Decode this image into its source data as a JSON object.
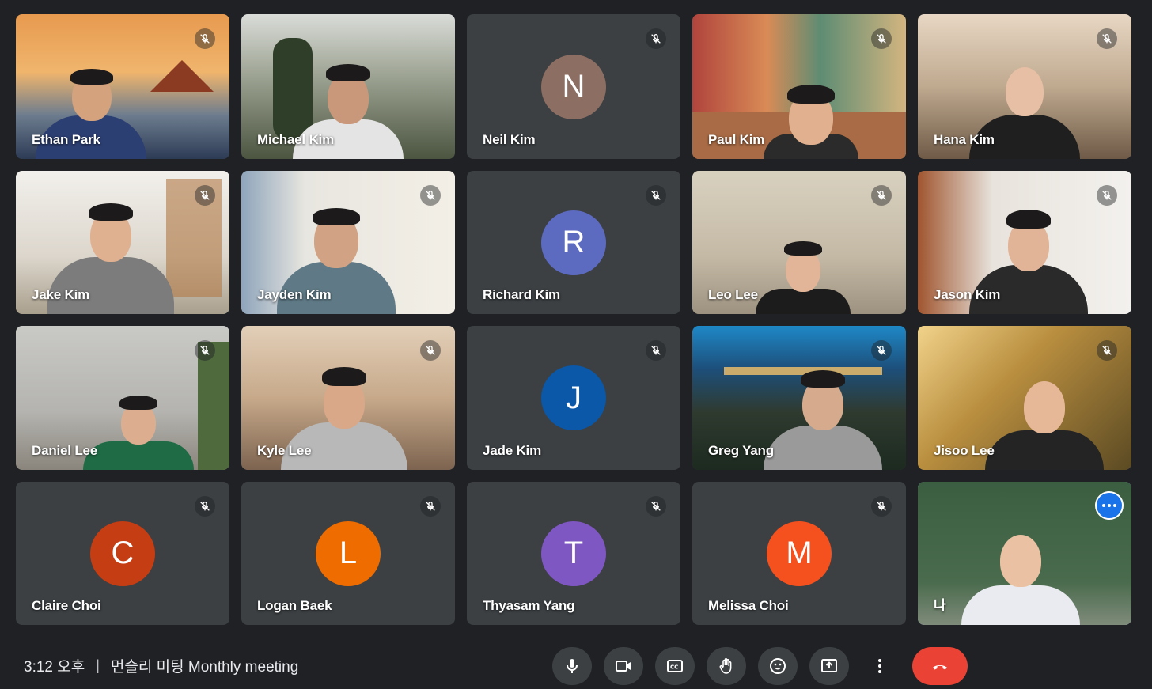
{
  "participants": [
    {
      "name": "Ethan Park",
      "type": "video"
    },
    {
      "name": "Michael Kim",
      "type": "video"
    },
    {
      "name": "Neil Kim",
      "type": "avatar",
      "initial": "N",
      "color": "#8d6e63"
    },
    {
      "name": "Paul Kim",
      "type": "video"
    },
    {
      "name": "Hana Kim",
      "type": "video"
    },
    {
      "name": "Jake Kim",
      "type": "video"
    },
    {
      "name": "Jayden Kim",
      "type": "video"
    },
    {
      "name": "Richard Kim",
      "type": "avatar",
      "initial": "R",
      "color": "#5c6bc0"
    },
    {
      "name": "Leo Lee",
      "type": "video"
    },
    {
      "name": "Jason Kim",
      "type": "video"
    },
    {
      "name": "Daniel Lee",
      "type": "video"
    },
    {
      "name": "Kyle Lee",
      "type": "video"
    },
    {
      "name": "Jade Kim",
      "type": "avatar",
      "initial": "J",
      "color": "#0b57a8"
    },
    {
      "name": "Greg Yang",
      "type": "video"
    },
    {
      "name": "Jisoo Lee",
      "type": "video"
    },
    {
      "name": "Claire Choi",
      "type": "avatar",
      "initial": "C",
      "color": "#c53d13"
    },
    {
      "name": "Logan Baek",
      "type": "avatar",
      "initial": "L",
      "color": "#ef6c00"
    },
    {
      "name": "Thyasam Yang",
      "type": "avatar",
      "initial": "T",
      "color": "#7e57c2"
    },
    {
      "name": "Melissa Choi",
      "type": "avatar",
      "initial": "M",
      "color": "#f4511e"
    },
    {
      "name": "나",
      "type": "video",
      "self": true
    }
  ],
  "meeting": {
    "time": "3:12 오후",
    "separator": "|",
    "title": "먼슬리 미팅 Monthly meeting"
  },
  "controls": [
    "mic-icon",
    "camera-icon",
    "captions-icon",
    "raise-hand-icon",
    "emoji-icon",
    "present-icon",
    "more-vert-icon",
    "end-call-icon"
  ],
  "colors": {
    "accent": "#8ab4f8",
    "end_call": "#ea4335",
    "tile": "#3c4043",
    "background": "#202124"
  }
}
